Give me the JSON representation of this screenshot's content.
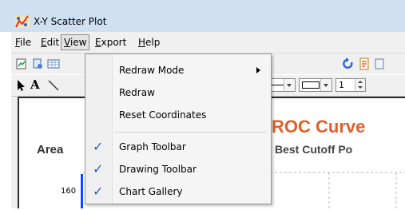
{
  "window": {
    "title": "X-Y Scatter Plot"
  },
  "menubar": [
    {
      "label": "File",
      "accel": "F",
      "rest": "ile"
    },
    {
      "label": "Edit",
      "accel": "E",
      "rest": "dit"
    },
    {
      "label": "View",
      "accel": "V",
      "rest": "iew",
      "open": true
    },
    {
      "label": "Export",
      "accel": "E",
      "rest": "xport"
    },
    {
      "label": "Help",
      "accel": "H",
      "rest": "elp"
    }
  ],
  "view_menu": {
    "items": [
      {
        "label": "Redraw Mode",
        "has_submenu": true,
        "checked": false
      },
      {
        "label": "Redraw",
        "has_submenu": false,
        "checked": false
      },
      {
        "label": "Reset Coordinates",
        "has_submenu": false,
        "checked": false
      },
      {
        "label": "Graph Toolbar",
        "has_submenu": false,
        "checked": true
      },
      {
        "label": "Drawing Toolbar",
        "has_submenu": false,
        "checked": true
      },
      {
        "label": "Chart Gallery",
        "has_submenu": false,
        "checked": true
      }
    ],
    "check_glyph": "✓"
  },
  "toolbar2": {
    "text_tool": "A",
    "line_width_value": "1"
  },
  "chart": {
    "title": "ROC Curve",
    "subtitle": "Best Cutoff Po",
    "y_axis_title": "Area",
    "y_tick": "160"
  },
  "colors": {
    "title_bar": "#cfe0f3",
    "chart_title": "#e35f2a",
    "check": "#2b5fb3",
    "plot_line": "#0050ff"
  },
  "icons": {
    "app": "scatter-plot-app-icon",
    "redraw": "redraw-arrow-icon"
  }
}
